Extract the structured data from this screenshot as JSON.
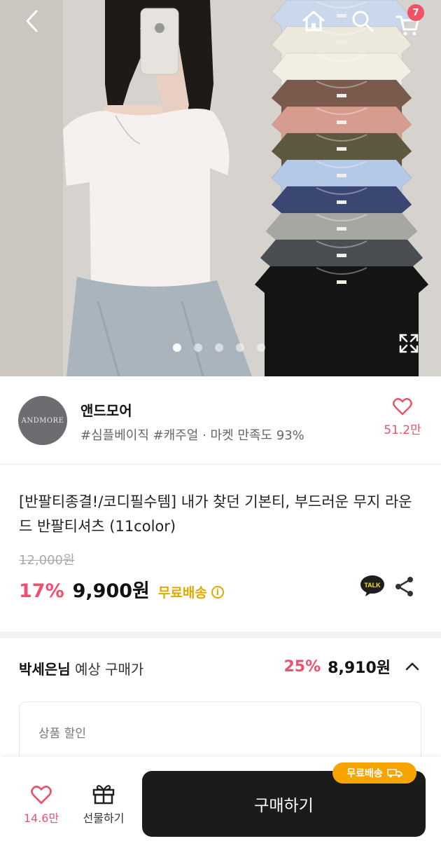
{
  "header": {
    "cart_count": "7"
  },
  "hero": {
    "slide_count": 5,
    "active_slide": 1,
    "tshirt_colors": [
      "#c9d8ea",
      "#ece8dc",
      "#f1eee4",
      "#7a5a4d",
      "#d79c90",
      "#5e5840",
      "#b4c8e8",
      "#3b4773",
      "#a6a6a2",
      "#4a4d52",
      "#141414"
    ]
  },
  "store": {
    "logo_text": "ANDMORE",
    "name": "앤드모어",
    "tags": "#심플베이직 #캐주얼 · 마켓 만족도 93%",
    "like_count": "51.2만"
  },
  "product": {
    "title": "[반팔티종결!/코디필수템] 내가 찾던 기본티, 부드러운 무지 라운드 반팔티셔츠 (11color)",
    "original_price": "12,000원",
    "discount": "17%",
    "price": "9,900원",
    "free_shipping": "무료배송",
    "talk_label": "TALK"
  },
  "expected": {
    "user_name": "박세은님",
    "label": "예상 구매가",
    "discount": "25%",
    "price": "8,910원"
  },
  "coupon": {
    "label": "상품 할인"
  },
  "bottom_bar": {
    "like_count": "14.6만",
    "gift_label": "선물하기",
    "buy_label": "구매하기",
    "free_shipping_badge": "무료배송"
  },
  "colors": {
    "accent_pink": "#f0506e",
    "free_ship_yellow": "#e0a800",
    "badge_orange": "#f7a400",
    "buy_button": "#1b1b1b"
  }
}
